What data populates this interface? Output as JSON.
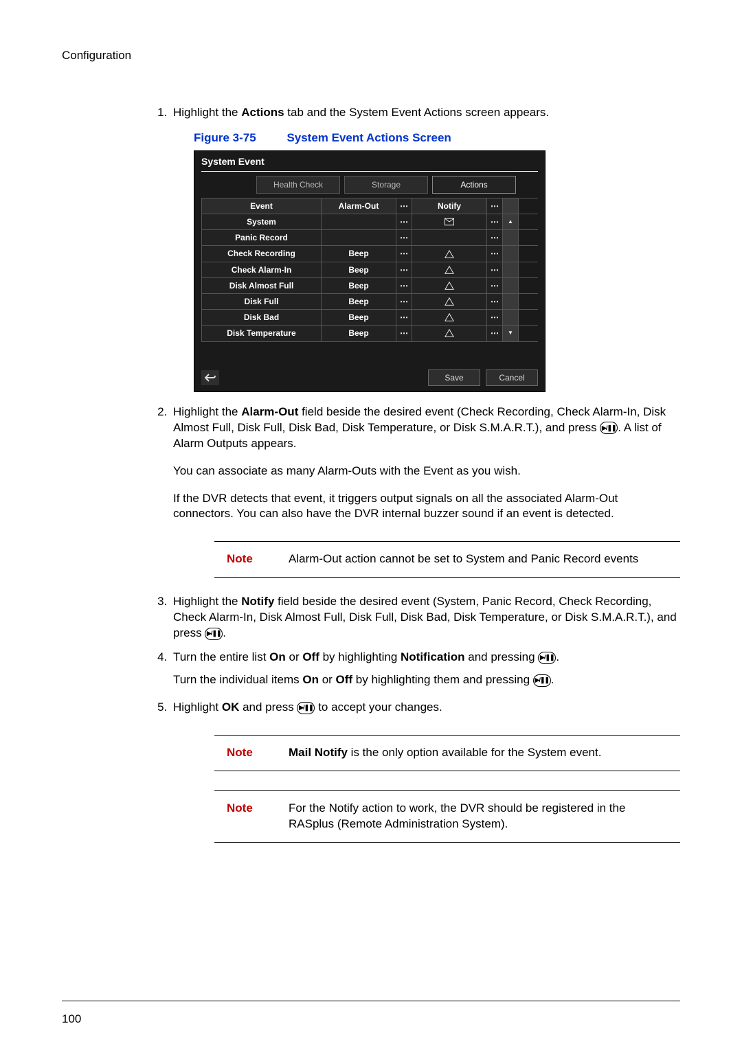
{
  "header": {
    "section": "Configuration"
  },
  "step1": {
    "pre": "Highlight the ",
    "bold": "Actions",
    "post": " tab and the System Event Actions screen appears."
  },
  "figure": {
    "num": "Figure 3-75",
    "title": "System Event Actions Screen"
  },
  "shot": {
    "title": "System Event",
    "tabs": {
      "health": "Health Check",
      "storage": "Storage",
      "actions": "Actions"
    },
    "headers": {
      "event": "Event",
      "alarm": "Alarm-Out",
      "notify": "Notify"
    },
    "rows": [
      {
        "event": "System",
        "alarm": "",
        "notify_icon": "mail"
      },
      {
        "event": "Panic Record",
        "alarm": "",
        "notify_icon": ""
      },
      {
        "event": "Check Recording",
        "alarm": "Beep",
        "notify_icon": "warn"
      },
      {
        "event": "Check Alarm-In",
        "alarm": "Beep",
        "notify_icon": "warn"
      },
      {
        "event": "Disk Almost Full",
        "alarm": "Beep",
        "notify_icon": "warn"
      },
      {
        "event": "Disk Full",
        "alarm": "Beep",
        "notify_icon": "warn"
      },
      {
        "event": "Disk Bad",
        "alarm": "Beep",
        "notify_icon": "warn"
      },
      {
        "event": "Disk Temperature",
        "alarm": "Beep",
        "notify_icon": "warn"
      }
    ],
    "buttons": {
      "save": "Save",
      "cancel": "Cancel"
    }
  },
  "step2": {
    "p1a": "Highlight the ",
    "p1b": "Alarm-Out",
    "p1c": " field beside the desired event (Check Recording, Check Alarm-In, Disk Almost Full, Disk Full, Disk Bad, Disk Temperature, or Disk S.M.A.R.T.), and press ",
    "p1d": ". A list of Alarm Outputs appears.",
    "p2": "You can associate as many Alarm-Outs with the Event as you wish.",
    "p3": "If the DVR detects that event, it triggers output signals on all the associated Alarm-Out connectors. You can also have the DVR internal buzzer sound if an event is detected."
  },
  "note1": {
    "label": "Note",
    "text": "Alarm-Out action cannot be set to System and Panic Record events"
  },
  "step3": {
    "a": "Highlight the ",
    "b": "Notify",
    "c": " field beside the desired event (System, Panic Record, Check Recording, Check Alarm-In, Disk Almost Full, Disk Full, Disk Bad, Disk Temperature, or Disk S.M.A.R.T.), and press ",
    "d": "."
  },
  "step4": {
    "l1a": "Turn the entire list ",
    "l1b": "On",
    "l1c": " or ",
    "l1d": "Off",
    "l1e": " by highlighting ",
    "l1f": "Notification",
    "l1g": " and pressing ",
    "l1h": ".",
    "l2a": "Turn the individual items ",
    "l2b": "On",
    "l2c": " or ",
    "l2d": "Off",
    "l2e": " by highlighting them and pressing ",
    "l2f": "."
  },
  "step5": {
    "a": "Highlight ",
    "b": "OK",
    "c": " and press ",
    "d": " to accept your changes."
  },
  "note2": {
    "label": "Note",
    "b": "Mail Notify",
    "text": " is the only option available for the System event."
  },
  "note3": {
    "label": "Note",
    "text": "For the Notify action to work, the DVR should be registered in the RASplus (Remote Administration System)."
  },
  "footer": {
    "pageno": "100"
  }
}
